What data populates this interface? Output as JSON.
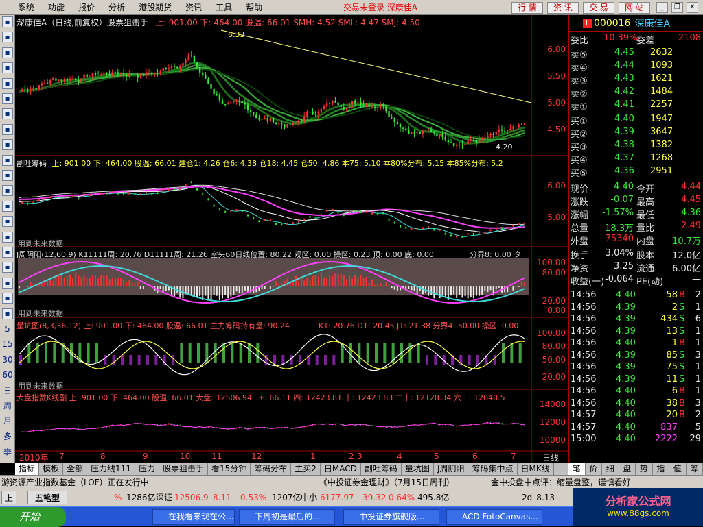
{
  "menu": [
    "系统",
    "功能",
    "报价",
    "分析",
    "港股期货",
    "资讯",
    "工具",
    "帮助"
  ],
  "status_text": "交易未登录  深康佳A",
  "top_buttons": [
    "行 情",
    "资 讯",
    "交 易",
    "网 站"
  ],
  "toolbar_icons": [
    "grid-icon",
    "list-icon",
    "line-icon",
    "bars-icon",
    "report-icon",
    "news-icon",
    "f10-icon",
    "info-icon",
    "data-icon",
    "info2-icon",
    "f10b-icon",
    "fiz-icon",
    "zoom-icon",
    "chart-icon",
    "rsi-icon",
    "buy-icon",
    "up-icon",
    "down-icon",
    "pen-icon",
    "f5-icon",
    "5",
    "15",
    "30",
    "60",
    "日",
    "周",
    "月",
    "多",
    "季"
  ],
  "main": {
    "title": "深康佳A（日线,前复权）股票狙击手",
    "params": "上: 901.00  下: 464.00  股温: 66.01  SMH: 4.52  SML: 4.47  SMJ: 4.50",
    "high_label": "6.33",
    "low_label": "4.20",
    "y_ticks": [
      "6.00",
      "5.50",
      "5.00",
      "4.50"
    ],
    "top_marks": [
      "4.45",
      "4.45",
      "4.46",
      "4.46"
    ]
  },
  "pane2": {
    "title": "副吐筹码",
    "params": "上: 901.00  下: 464.00  股温: 66.01  建仓1: 4.26  仓6: 4.38  仓18: 4.45  仓50: 4.86  本75: 5.10  本80%分布: 5.15  本85%分布: 5.2",
    "note": "用到未来数据",
    "y_ticks": [
      "6.00",
      "5.00"
    ]
  },
  "pane3": {
    "title": "J周阴阳(12,60,9)  K11111周: 20.76  D11111周: 21.26  空头60日线位置: 80.22  观区: 0.00  操区: 0.23  顶: 0.00  底: 0.00",
    "right": "分界8: 0.00  タ",
    "note": "用到未来数据",
    "y_ticks": [
      "100.00",
      "80.00",
      "20.00",
      "0.00"
    ]
  },
  "pane4": {
    "title": "量坑图(8,3,36,12)  上: 901.00  下: 464.00  股温: 66.01  主力筹码持有量: 90.24",
    "right": "K1: 20.76  D1: 20.45  J1: 21.38  分界4: 50.00  操区: 0.00",
    "note": "用到未来数据",
    "y_ticks": [
      "100.00",
      "80.00",
      "50.00",
      "20.00"
    ]
  },
  "pane5": {
    "title": "大盘指数K线副  上: 901.00  下: 464.00  股温: 66.01  大盘: 12506.94  _±: 66.11  四: 12423.81  十: 12423.83  二十: 12128.34  六十: 12040.5",
    "y_ticks": [
      "14000",
      "12000",
      "10000"
    ]
  },
  "x_axis": {
    "labels": [
      "2010年",
      "7",
      "8",
      "9",
      "10",
      "11",
      "12",
      "1",
      "2",
      "3",
      "4",
      "5",
      "6",
      "7"
    ],
    "period": "日线"
  },
  "tabs": [
    "指标",
    "模板",
    "全部",
    "压力线111",
    "压力",
    "股票狙击手",
    "看15分钟",
    "筹码分布",
    "主买2",
    "日MACD",
    "副吐筹码",
    "量坑图",
    "J周阴阳",
    "筹码集中点",
    "日MK线"
  ],
  "side": {
    "code": "000016",
    "name": "深康佳A",
    "weibi_label": "委比",
    "weibi": "10.39%",
    "weicha_label": "委差",
    "weicha": "2108",
    "asks": [
      {
        "label": "卖⑤",
        "price": "4.45",
        "vol": "2632"
      },
      {
        "label": "卖④",
        "price": "4.44",
        "vol": "1093"
      },
      {
        "label": "卖③",
        "price": "4.43",
        "vol": "1621"
      },
      {
        "label": "卖②",
        "price": "4.42",
        "vol": "1484"
      },
      {
        "label": "卖①",
        "price": "4.41",
        "vol": "2257"
      }
    ],
    "bids": [
      {
        "label": "买①",
        "price": "4.40",
        "vol": "1947"
      },
      {
        "label": "买②",
        "price": "4.39",
        "vol": "3647"
      },
      {
        "label": "买③",
        "price": "4.38",
        "vol": "1382"
      },
      {
        "label": "买④",
        "price": "4.37",
        "vol": "1268"
      },
      {
        "label": "买⑤",
        "price": "4.36",
        "vol": "2951"
      }
    ],
    "stats": [
      {
        "l1": "现价",
        "v1": "4.40",
        "l2": "今开",
        "v2": "4.44"
      },
      {
        "l1": "涨跌",
        "v1": "-0.07",
        "l2": "最高",
        "v2": "4.45"
      },
      {
        "l1": "涨幅",
        "v1": "-1.57%",
        "l2": "最低",
        "v2": "4.36"
      },
      {
        "l1": "总量",
        "v1": "18.3万",
        "l2": "量比",
        "v2": "2.49"
      },
      {
        "l1": "外盘",
        "v1": "75340",
        "l2": "内盘",
        "v2": "10.7万"
      }
    ],
    "stats2": [
      {
        "l1": "换手",
        "v1": "3.04%",
        "l2": "股本",
        "v2": "12.0亿"
      },
      {
        "l1": "净资",
        "v1": "3.25",
        "l2": "流通",
        "v2": "6.00亿"
      },
      {
        "l1": "收益(一)",
        "v1": "-0.064",
        "l2": "PE(动)",
        "v2": "—"
      }
    ],
    "ticks": [
      {
        "t": "14:56",
        "p": "4.40",
        "v": "58",
        "d": "B",
        "n": "2"
      },
      {
        "t": "14:56",
        "p": "4.39",
        "v": "2",
        "d": "S",
        "n": "1"
      },
      {
        "t": "14:56",
        "p": "4.39",
        "v": "434",
        "d": "S",
        "n": "6"
      },
      {
        "t": "14:56",
        "p": "4.39",
        "v": "13",
        "d": "S",
        "n": "1"
      },
      {
        "t": "14:56",
        "p": "4.40",
        "v": "1",
        "d": "B",
        "n": "1"
      },
      {
        "t": "14:56",
        "p": "4.39",
        "v": "85",
        "d": "S",
        "n": "3"
      },
      {
        "t": "14:56",
        "p": "4.39",
        "v": "75",
        "d": "S",
        "n": "1"
      },
      {
        "t": "14:56",
        "p": "4.39",
        "v": "11",
        "d": "S",
        "n": "1"
      },
      {
        "t": "14:56",
        "p": "4.40",
        "v": "6",
        "d": "B",
        "n": "1"
      },
      {
        "t": "14:56",
        "p": "4.40",
        "v": "38",
        "d": "B",
        "n": "3"
      },
      {
        "t": "14:57",
        "p": "4.40",
        "v": "20",
        "d": "B",
        "n": "2"
      },
      {
        "t": "14:57",
        "p": "4.40",
        "v": "837",
        "d": "",
        "n": "5"
      },
      {
        "t": "15:00",
        "p": "4.40",
        "v": "2222",
        "d": "",
        "n": "29"
      }
    ],
    "tabs": [
      "笔",
      "价",
      "细",
      "盘",
      "势",
      "指",
      "值",
      "筹"
    ]
  },
  "ticker": {
    "left": "游资源产业指数基金（LOF）正在发行中",
    "mid": "《中投证券金理财》（7月15日周刊）",
    "right": "金中投盘中点评：缩量盘整，谨慎看好"
  },
  "indexbar": {
    "btn1": "上",
    "btn2": "五笔型",
    "pct": "%",
    "amt1": "1286亿",
    "name2": "深证",
    "val2": "12506.9",
    "chg2": "8.11",
    "pct2": "0.53%",
    "amt2": "1207亿",
    "name3": "中小",
    "val3": "6177.97",
    "chg3": "39.32",
    "pct3": "0.64%",
    "amt3": "495.8亿",
    "date": "2d_8.13"
  },
  "taskbar": {
    "start": "开始",
    "tasks": [
      "在我看来现在公...",
      "下周初是最后的...",
      "中投证券旗舰版...",
      "ACD FotoCanvas..."
    ]
  },
  "brand": {
    "name": "分析家公式网",
    "url": "www.88gs.com"
  },
  "colors": {
    "up": "#ff3030",
    "down": "#38e838",
    "accent": "#ffff40",
    "bg": "#000000"
  }
}
